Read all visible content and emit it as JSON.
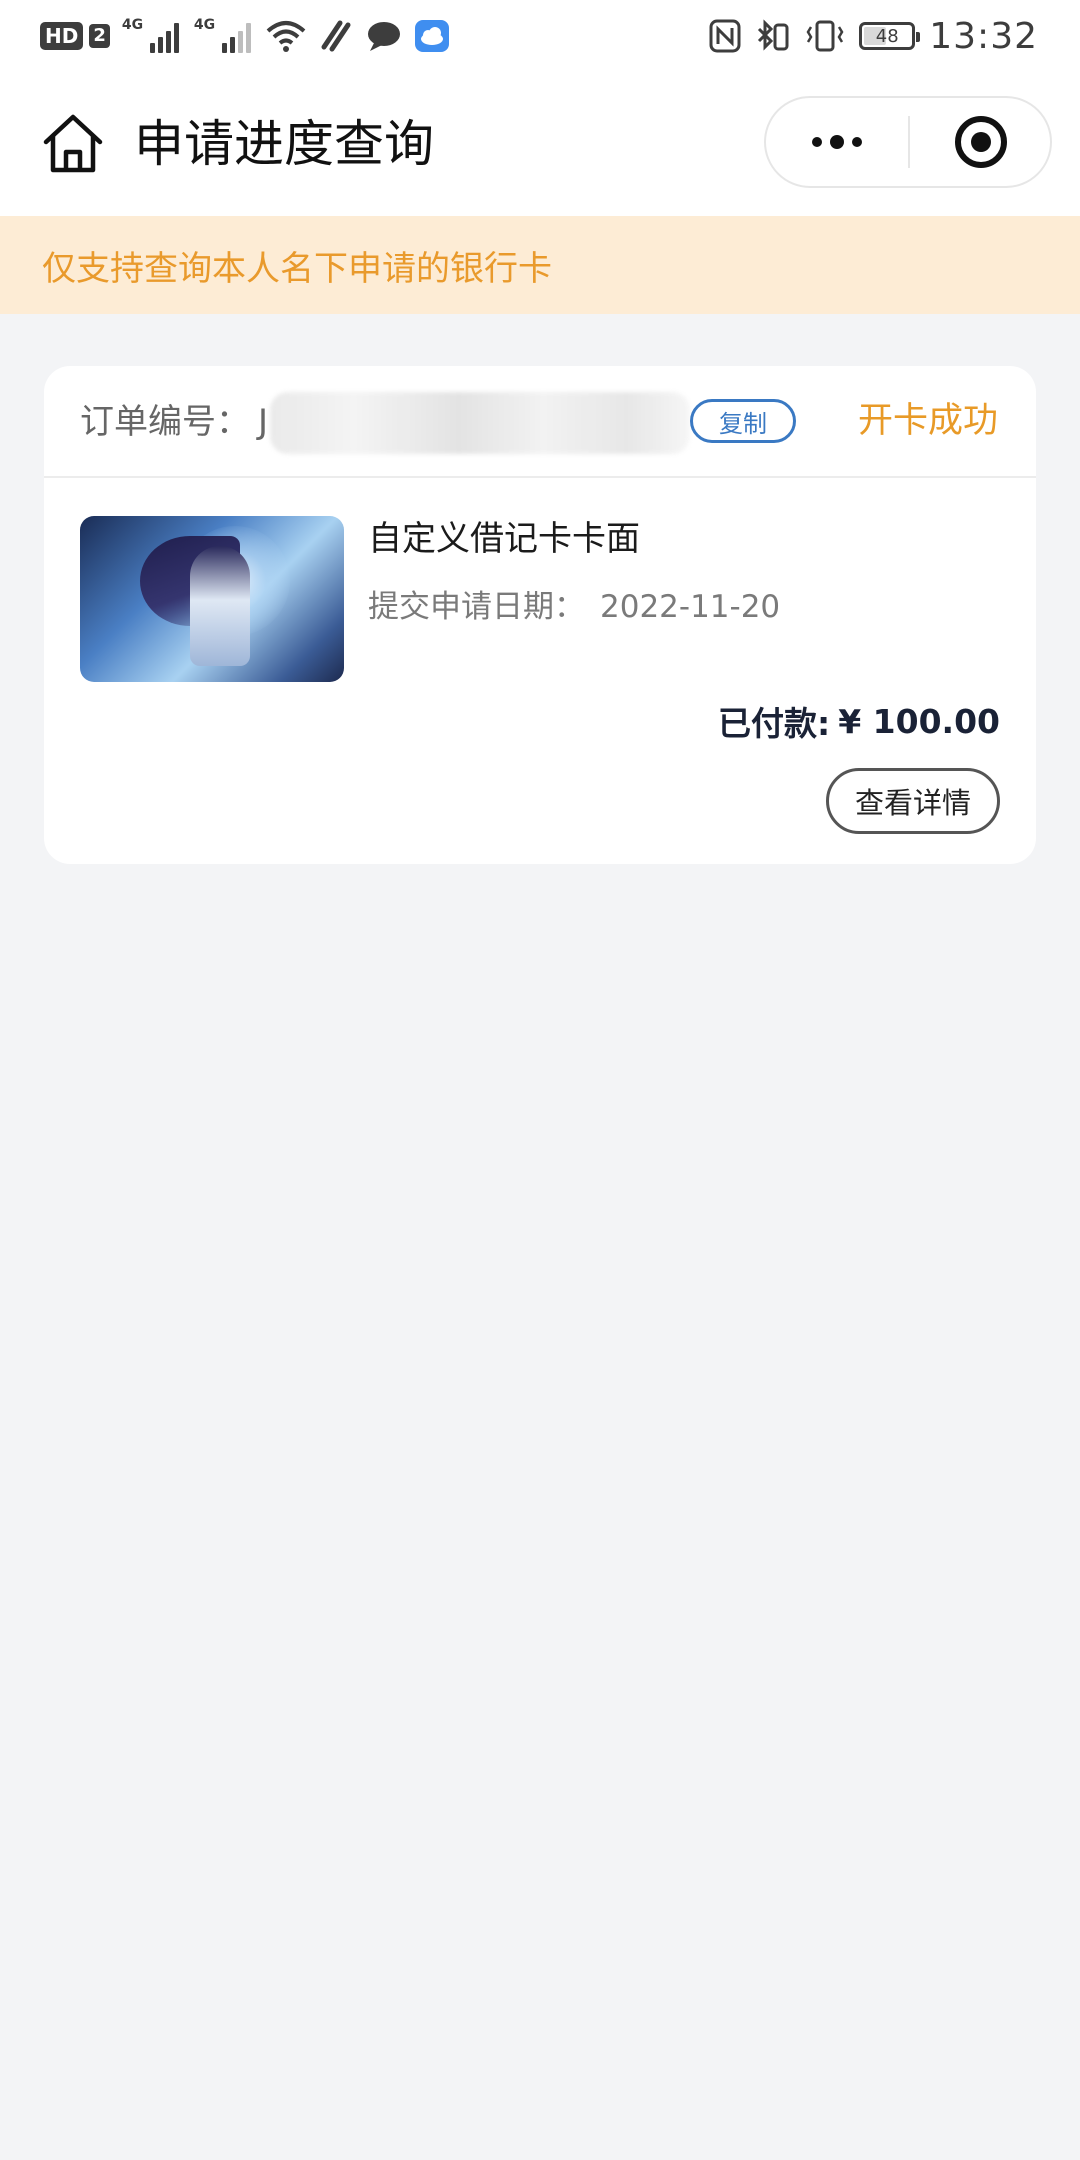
{
  "status_bar": {
    "hd_badge": "HD",
    "sim_slot": "2",
    "network_1": "4G",
    "network_2": "4G",
    "battery_level": "48",
    "battery_fraction": 0.48,
    "time": "13:32",
    "icons": [
      "hd-icon",
      "signal-icon",
      "signal-weak-icon",
      "wifi-icon",
      "data-saver-icon",
      "message-icon",
      "cloud-icon",
      "nfc-icon",
      "bluetooth-icon",
      "vibrate-icon",
      "battery-icon"
    ]
  },
  "nav": {
    "title": "申请进度查询",
    "home_icon": "home-icon",
    "more_icon": "more-dots-icon",
    "close_icon": "close-miniprogram-icon"
  },
  "notice": {
    "text": "仅支持查询本人名下申请的银行卡"
  },
  "order": {
    "number_label": "订单编号：",
    "number_value": "J",
    "copy_label": "复制",
    "status": "开卡成功",
    "product_title": "自定义借记卡卡面",
    "date_label": "提交申请日期：",
    "date_value": "2022-11-20",
    "paid_label": "已付款:",
    "paid_amount": "¥ 100.00",
    "detail_button": "查看详情"
  },
  "colors": {
    "background": "#f3f4f6",
    "notice_bg": "#fdecd5",
    "accent_orange": "#e99a2c",
    "copy_blue": "#3a79c3",
    "text_dark": "#1a2236"
  }
}
